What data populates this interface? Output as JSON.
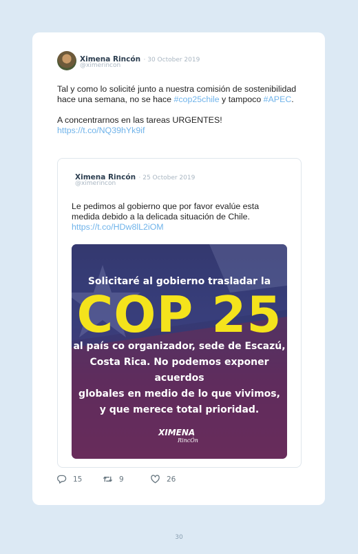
{
  "tweet": {
    "author": "Ximena Rincón",
    "date": "· 30 October 2019",
    "handle": "@ximerincon",
    "text_1": "Tal y como lo solicité junto a nuestra comisión de sostenibilidad hace una semana, no se hace ",
    "hashtag_cop": "#cop25chile",
    "text_2": " y tampoco ",
    "hashtag_apec": "#APEC",
    "text_3": ".",
    "text_4": "A concentrarnos en las tareas URGENTES!",
    "link": "https://t.co/NQ39hYk9if"
  },
  "quoted": {
    "author": "Ximena Rincón",
    "date": "· 25 October 2019",
    "handle": "@ximerincon",
    "text": "Le pedimos al gobierno que por favor evalúe esta medida debido a la delicada situación de Chile.",
    "link": "https://t.co/HDw8lL2iOM"
  },
  "promo_image": {
    "line1": "Solicitaré al gobierno trasladar la",
    "headline": "COP 25",
    "line2": "al país co organizador, sede de Escazú,",
    "line3": "Costa Rica. No podemos exponer acuerdos",
    "line4": "globales en medio de lo que vivimos,",
    "line5": "y que merece total prioridad.",
    "logo_top": "XIMENA",
    "logo_bottom": "RincÓn",
    "headline_color": "#f4e31c"
  },
  "actions": {
    "replies": "15",
    "retweets": "9",
    "likes": "26"
  },
  "page_number": "30",
  "colors": {
    "link": "#6fb3ea",
    "page_background": "#dce9f4"
  }
}
